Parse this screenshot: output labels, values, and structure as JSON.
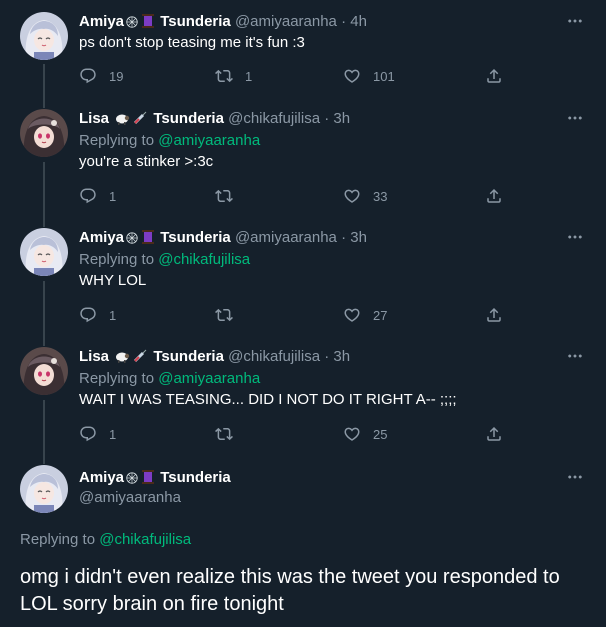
{
  "tweets": [
    {
      "name": "Amiya",
      "suffix": "Tsunderia",
      "handle": "@amiyaaranha",
      "time": "4h",
      "text": "ps don't stop teasing me it's fun :3",
      "reply_count": "19",
      "retweet_count": "1",
      "like_count": "101"
    },
    {
      "name": "Lisa",
      "suffix": "Tsunderia",
      "handle": "@chikafujilisa",
      "time": "3h",
      "replying_label": "Replying to",
      "replying_to": "@amiyaaranha",
      "text": "you're a stinker >:3c",
      "reply_count": "1",
      "retweet_count": "",
      "like_count": "33"
    },
    {
      "name": "Amiya",
      "suffix": "Tsunderia",
      "handle": "@amiyaaranha",
      "time": "3h",
      "replying_label": "Replying to",
      "replying_to": "@chikafujilisa",
      "text": "WHY LOL",
      "reply_count": "1",
      "retweet_count": "",
      "like_count": "27"
    },
    {
      "name": "Lisa",
      "suffix": "Tsunderia",
      "handle": "@chikafujilisa",
      "time": "3h",
      "replying_label": "Replying to",
      "replying_to": "@amiyaaranha",
      "text": "WAIT I WAS TEASING... DID I NOT DO IT RIGHT A-- ;;;;",
      "reply_count": "1",
      "retweet_count": "",
      "like_count": "25"
    }
  ],
  "focused": {
    "name": "Amiya",
    "suffix": "Tsunderia",
    "handle": "@amiyaaranha",
    "replying_label": "Replying to",
    "replying_to": "@chikafujilisa",
    "text": "omg i didn't even realize this was the tweet you responded to LOL sorry brain on fire tonight"
  },
  "icons": {
    "reply": "reply-icon",
    "retweet": "retweet-icon",
    "like": "heart-icon",
    "share": "share-icon",
    "more": "more-icon"
  },
  "colors": {
    "background": "#15202b",
    "mention": "#00ba7c",
    "secondary_text": "#8b98a5"
  }
}
